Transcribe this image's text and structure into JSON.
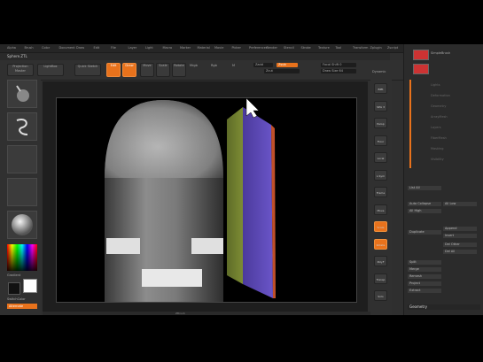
{
  "menu": [
    "Alpha",
    "Brush",
    "Color",
    "Document",
    "Draw",
    "Edit",
    "File",
    "Layer",
    "Light",
    "Macro",
    "Marker",
    "Material",
    "Movie",
    "Picker",
    "Preferences",
    "Render",
    "Stencil",
    "Stroke",
    "Texture",
    "Tool",
    "Transform",
    "Zplugin",
    "Zscript"
  ],
  "file_title": "Sphere.ZTL",
  "toolbar": {
    "projection_label": "Projection Master",
    "lightbox_label": "LightBox",
    "quicksketch_label": "Quick Sketch",
    "edit_label": "Edit",
    "draw_label": "Draw",
    "move_label": "Move",
    "scale_label": "Scale",
    "rotate_label": "Rotate",
    "mrgb_label": "Mrgb",
    "rgb_label": "Rgb",
    "m_label": "M",
    "zadd_label": "Zadd",
    "zsub_label": "Zsub",
    "zcut_label": "Zcut",
    "focal_label": "Focal Shift 0",
    "drawsize_label": "Draw Size 64",
    "dynamic_label": "Dynamic",
    "intensity_label": "Z Intensity 25"
  },
  "left": {
    "color_label": "Gradient",
    "alt_label": "SwitchColor",
    "alternate_label": "Alternate"
  },
  "right_shelf": [
    "BPR",
    "SPix 3",
    "Persp",
    "Floor",
    "Local",
    "L.Sym",
    "Frame",
    "Move",
    "Scale",
    "Rotate",
    "PolyF",
    "Transp",
    "Solo"
  ],
  "panel": {
    "tool_label": "SimpleBrush",
    "subtool_label": "Subtool",
    "items": [
      "Lights",
      "Deformation",
      "Geometry",
      "ArrayMesh",
      "Layers",
      "FiberMesh",
      "Masking",
      "Visibility",
      "Polygroups",
      "Contact",
      "Morph Target",
      "Polypaint",
      "UV Map",
      "Texture Map",
      "Displacement",
      "Normal Map",
      "Vector Displacement",
      "Unified Skin",
      "Initialize",
      "Import",
      "Export"
    ],
    "list_all": "List All",
    "auto_collapse": "Auto Collapse",
    "all_low": "All Low",
    "all_high": "All High",
    "duplicate": "Duplicate",
    "append": "Append",
    "insert": "Insert",
    "delete": "Del Other",
    "del_all": "Del All",
    "split": "Split",
    "merge": "Merge",
    "remesh": "Remesh",
    "project": "Project",
    "extract": "Extract",
    "geometry": "Geometry"
  },
  "colors": {
    "accent": "#e8721c",
    "background": "#2f2f2f",
    "canvas": "#000000"
  },
  "bottom_label": "ZBrush"
}
